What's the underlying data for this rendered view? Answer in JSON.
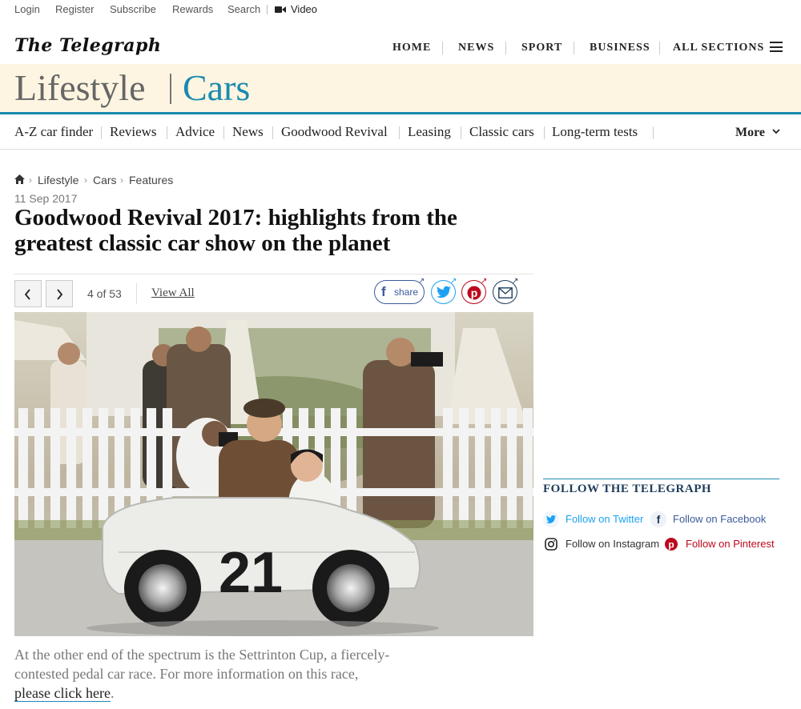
{
  "util_bar": {
    "links": [
      "Login",
      "Register",
      "Subscribe",
      "Rewards",
      "Search"
    ],
    "video_label": "Video"
  },
  "masthead": {
    "logo": "The Telegraph",
    "nav": [
      "HOME",
      "NEWS",
      "SPORT",
      "BUSINESS",
      "ALL SECTIONS"
    ]
  },
  "banner": {
    "section": "Lifestyle",
    "subsection": "Cars",
    "accent_color": "#1b8ab0",
    "background_color": "#fdf5e1"
  },
  "subnav": {
    "items": [
      "A-Z car finder",
      "Reviews",
      "Advice",
      "News",
      "Goodwood Revival",
      "Leasing",
      "Classic cars",
      "Long-term tests"
    ],
    "more_label": "More"
  },
  "breadcrumb": [
    "Lifestyle",
    "Cars",
    "Features"
  ],
  "article": {
    "date": "11 Sep 2017",
    "headline": "Goodwood Revival 2017: highlights from the greatest classic car show on the planet"
  },
  "gallery": {
    "counter": "4 of 53",
    "view_all": "View All",
    "share_label": "share",
    "caption_text": "At the other end of the spectrum is the Settrinton Cup, a fiercely-contested pedal car race. For more information on this race, ",
    "caption_link": "please click here",
    "caption_end": ".",
    "car_number": "21"
  },
  "follow": {
    "title": "FOLLOW THE TELEGRAPH",
    "twitter": "Follow on Twitter",
    "facebook": "Follow on Facebook",
    "instagram": "Follow on Instagram",
    "pinterest": "Follow on Pinterest",
    "twitter_color": "#1da1f2",
    "facebook_color": "#3b5a9a",
    "pinterest_color": "#bd081c"
  }
}
